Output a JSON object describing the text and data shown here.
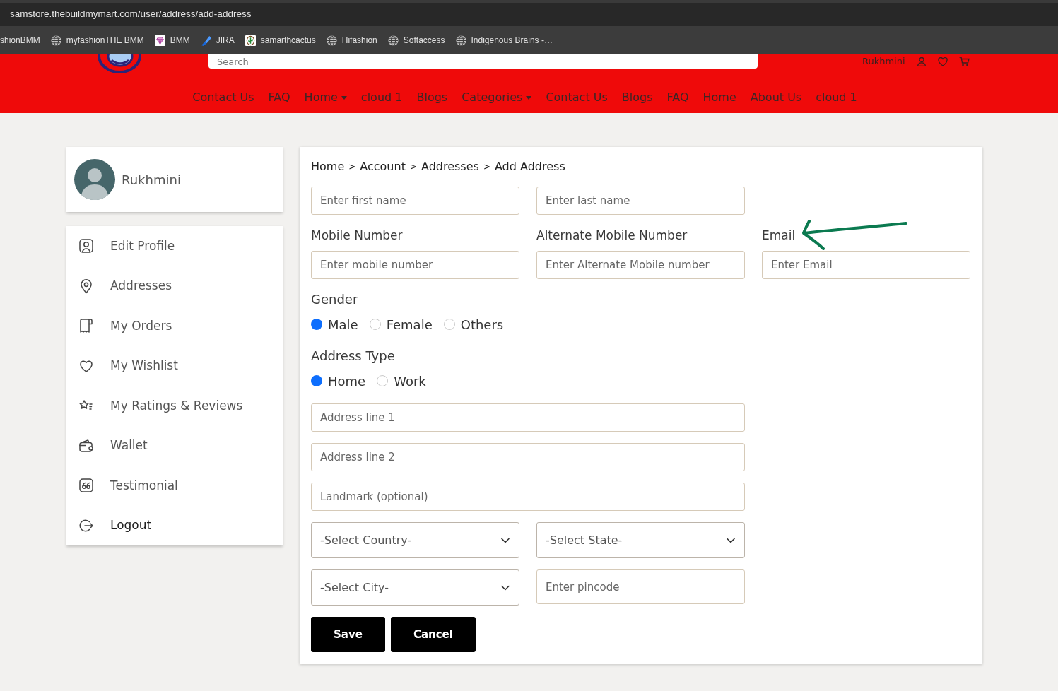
{
  "browser": {
    "url": "samstore.thebuildmymart.com/user/address/add-address",
    "bookmarks": [
      {
        "label": "shionBMM",
        "kind": "none"
      },
      {
        "label": "myfashionTHE BMM",
        "kind": "globe"
      },
      {
        "label": "BMM",
        "kind": "gem"
      },
      {
        "label": "JIRA",
        "kind": "slash"
      },
      {
        "label": "samarthcactus",
        "kind": "cactus"
      },
      {
        "label": "Hifashion",
        "kind": "globe"
      },
      {
        "label": "Softaccess",
        "kind": "globe"
      },
      {
        "label": "Indigenous Brains -…",
        "kind": "globe"
      }
    ]
  },
  "header": {
    "search": {
      "placeholder": "Search"
    },
    "account_name": "Rukhmini",
    "nav": [
      {
        "label": "Contact Us",
        "dropdown": false
      },
      {
        "label": "FAQ",
        "dropdown": false
      },
      {
        "label": "Home",
        "dropdown": true
      },
      {
        "label": "cloud 1",
        "dropdown": false
      },
      {
        "label": "Blogs",
        "dropdown": false
      },
      {
        "label": "Categories",
        "dropdown": true
      },
      {
        "label": "Contact Us",
        "dropdown": false
      },
      {
        "label": "Blogs",
        "dropdown": false
      },
      {
        "label": "FAQ",
        "dropdown": false
      },
      {
        "label": "Home",
        "dropdown": false
      },
      {
        "label": "About Us",
        "dropdown": false
      },
      {
        "label": "cloud 1",
        "dropdown": false
      }
    ]
  },
  "sidebar": {
    "profile_name": "Rukhmini",
    "items": [
      {
        "label": "Edit Profile",
        "kind": "profile"
      },
      {
        "label": "Addresses",
        "kind": "address"
      },
      {
        "label": "My Orders",
        "kind": "orders"
      },
      {
        "label": "My Wishlist",
        "kind": "wishlist"
      },
      {
        "label": "My Ratings & Reviews",
        "kind": "reviews"
      },
      {
        "label": "Wallet",
        "kind": "wallet"
      },
      {
        "label": "Testimonial",
        "kind": "testimonial"
      },
      {
        "label": "Logout",
        "kind": "logout"
      }
    ]
  },
  "breadcrumb": [
    {
      "label": "Home",
      "separator": ">"
    },
    {
      "label": "Account",
      "separator": ">"
    },
    {
      "label": "Addresses",
      "separator": ">"
    },
    {
      "label": "Add Address"
    }
  ],
  "form": {
    "name_fields": [
      {
        "placeholder": "Enter first name"
      },
      {
        "placeholder": "Enter last name"
      }
    ],
    "contact_fields": [
      {
        "label": "Mobile Number",
        "placeholder": "Enter mobile number",
        "annotated": false
      },
      {
        "label": "Alternate Mobile Number",
        "placeholder": "Enter Alternate Mobile number",
        "annotated": false
      },
      {
        "label": "Email",
        "placeholder": "Enter Email",
        "annotated": true
      }
    ],
    "radio_groups": [
      {
        "label": "Gender",
        "options": [
          {
            "label": "Male",
            "selected": true
          },
          {
            "label": "Female",
            "selected": false
          },
          {
            "label": "Others",
            "selected": false
          }
        ]
      },
      {
        "label": "Address Type",
        "options": [
          {
            "label": "Home",
            "selected": true
          },
          {
            "label": "Work",
            "selected": false
          }
        ]
      }
    ],
    "address_fields": [
      {
        "placeholder": "Address line 1"
      },
      {
        "placeholder": "Address line 2"
      },
      {
        "placeholder": "Landmark (optional)"
      }
    ],
    "location_fields": [
      {
        "kind": "select",
        "value": "-Select Country-"
      },
      {
        "kind": "select",
        "value": "-Select State-"
      },
      {
        "kind": "select",
        "value": "-Select City-"
      },
      {
        "kind": "input",
        "placeholder": "Enter pincode"
      }
    ],
    "buttons": [
      {
        "label": "Save"
      },
      {
        "label": "Cancel"
      }
    ]
  }
}
